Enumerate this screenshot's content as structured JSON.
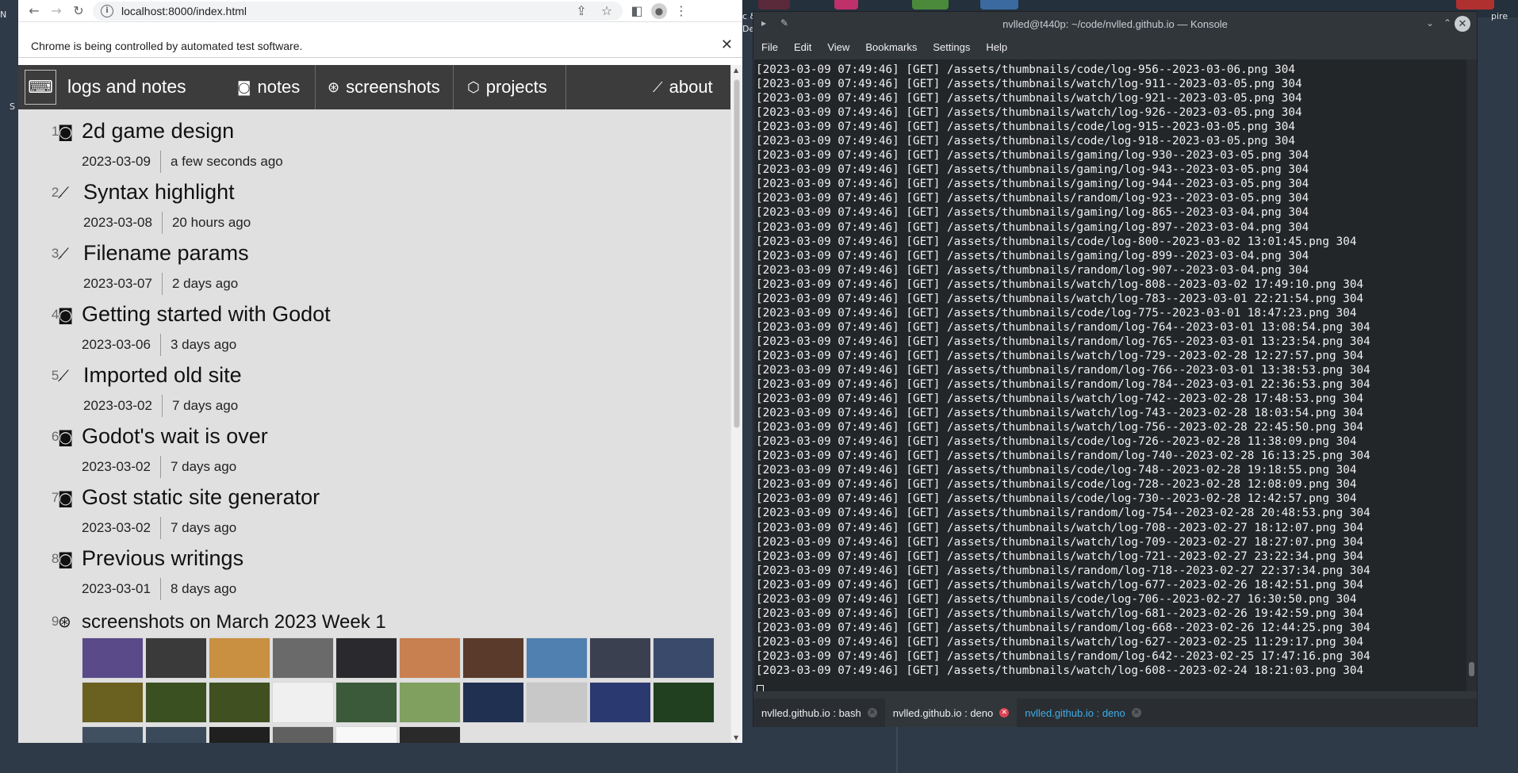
{
  "desktop": {
    "label_left": "N",
    "label_left2": "S",
    "label_right_a": "c &",
    "label_right_b": "De",
    "label_right_c": "pire"
  },
  "browser": {
    "url": "localhost:8000/index.html",
    "infobar_text": "Chrome is being controlled by automated test software.",
    "close_glyph": "✕",
    "icons": {
      "back": "←",
      "forward": "→",
      "reload": "↻",
      "site_info": "i",
      "share": "⇪",
      "star": "☆",
      "sidebar": "◧",
      "profile": "●",
      "menu": "⋮"
    }
  },
  "site": {
    "logo_icon": "⌨",
    "brand": "logs and notes",
    "nav": [
      {
        "icon": "◙",
        "label": "notes"
      },
      {
        "icon": "⊛",
        "label": "screenshots"
      },
      {
        "icon": "⬡",
        "label": "projects"
      },
      {
        "icon": "⟋",
        "label": "about"
      }
    ],
    "posts": [
      {
        "num": "1.",
        "icon": "◙",
        "title": "2d game design",
        "date": "2023-03-09",
        "ago": "a few seconds ago"
      },
      {
        "num": "2.",
        "icon": "⟋",
        "title": "Syntax highlight",
        "date": "2023-03-08",
        "ago": "20 hours ago"
      },
      {
        "num": "3.",
        "icon": "⟋",
        "title": "Filename params",
        "date": "2023-03-07",
        "ago": "2 days ago"
      },
      {
        "num": "4.",
        "icon": "◙",
        "title": "Getting started with Godot",
        "date": "2023-03-06",
        "ago": "3 days ago"
      },
      {
        "num": "5.",
        "icon": "⟋",
        "title": "Imported old site",
        "date": "2023-03-02",
        "ago": "7 days ago"
      },
      {
        "num": "6.",
        "icon": "◙",
        "title": "Godot's wait is over",
        "date": "2023-03-02",
        "ago": "7 days ago"
      },
      {
        "num": "7.",
        "icon": "◙",
        "title": "Gost static site generator",
        "date": "2023-03-02",
        "ago": "7 days ago"
      },
      {
        "num": "8.",
        "icon": "◙",
        "title": "Previous writings",
        "date": "2023-03-01",
        "ago": "8 days ago"
      },
      {
        "num": "9.",
        "icon": "⊛",
        "title": "screenshots on March 2023 Week 1",
        "date": "",
        "ago": ""
      }
    ],
    "thumb_colors": [
      "#5a4a8a",
      "#3a3a3a",
      "#c89040",
      "#6a6a6a",
      "#2a2a2e",
      "#c88050",
      "#5a3a2a",
      "#5080b0",
      "#3a4050",
      "#3a4a6a",
      "#6a6020",
      "#3a5020",
      "#405020",
      "#f0f0f0",
      "#3a5a3a",
      "#80a060",
      "#203050",
      "#c8c8c8",
      "#2a3a70",
      "#204020",
      "#405060",
      "#3a4a5a",
      "#202020",
      "#606060",
      "#f8f8f8",
      "#2a2a2a"
    ]
  },
  "konsole": {
    "title": "nvlled@t440p: ~/code/nvlled.github.io — Konsole",
    "menu": [
      "File",
      "Edit",
      "View",
      "Bookmarks",
      "Settings",
      "Help"
    ],
    "lines": [
      "[2023-03-09 07:49:46] [GET] /assets/thumbnails/code/log-956--2023-03-06.png 304",
      "[2023-03-09 07:49:46] [GET] /assets/thumbnails/watch/log-911--2023-03-05.png 304",
      "[2023-03-09 07:49:46] [GET] /assets/thumbnails/watch/log-921--2023-03-05.png 304",
      "[2023-03-09 07:49:46] [GET] /assets/thumbnails/watch/log-926--2023-03-05.png 304",
      "[2023-03-09 07:49:46] [GET] /assets/thumbnails/code/log-915--2023-03-05.png 304",
      "[2023-03-09 07:49:46] [GET] /assets/thumbnails/code/log-918--2023-03-05.png 304",
      "[2023-03-09 07:49:46] [GET] /assets/thumbnails/gaming/log-930--2023-03-05.png 304",
      "[2023-03-09 07:49:46] [GET] /assets/thumbnails/gaming/log-943--2023-03-05.png 304",
      "[2023-03-09 07:49:46] [GET] /assets/thumbnails/gaming/log-944--2023-03-05.png 304",
      "[2023-03-09 07:49:46] [GET] /assets/thumbnails/random/log-923--2023-03-05.png 304",
      "[2023-03-09 07:49:46] [GET] /assets/thumbnails/gaming/log-865--2023-03-04.png 304",
      "[2023-03-09 07:49:46] [GET] /assets/thumbnails/gaming/log-897--2023-03-04.png 304",
      "[2023-03-09 07:49:46] [GET] /assets/thumbnails/code/log-800--2023-03-02 13:01:45.png 304",
      "[2023-03-09 07:49:46] [GET] /assets/thumbnails/gaming/log-899--2023-03-04.png 304",
      "[2023-03-09 07:49:46] [GET] /assets/thumbnails/random/log-907--2023-03-04.png 304",
      "[2023-03-09 07:49:46] [GET] /assets/thumbnails/watch/log-808--2023-03-02 17:49:10.png 304",
      "[2023-03-09 07:49:46] [GET] /assets/thumbnails/watch/log-783--2023-03-01 22:21:54.png 304",
      "[2023-03-09 07:49:46] [GET] /assets/thumbnails/code/log-775--2023-03-01 18:47:23.png 304",
      "[2023-03-09 07:49:46] [GET] /assets/thumbnails/random/log-764--2023-03-01 13:08:54.png 304",
      "[2023-03-09 07:49:46] [GET] /assets/thumbnails/random/log-765--2023-03-01 13:23:54.png 304",
      "[2023-03-09 07:49:46] [GET] /assets/thumbnails/watch/log-729--2023-02-28 12:27:57.png 304",
      "[2023-03-09 07:49:46] [GET] /assets/thumbnails/random/log-766--2023-03-01 13:38:53.png 304",
      "[2023-03-09 07:49:46] [GET] /assets/thumbnails/random/log-784--2023-03-01 22:36:53.png 304",
      "[2023-03-09 07:49:46] [GET] /assets/thumbnails/watch/log-742--2023-02-28 17:48:53.png 304",
      "[2023-03-09 07:49:46] [GET] /assets/thumbnails/watch/log-743--2023-02-28 18:03:54.png 304",
      "[2023-03-09 07:49:46] [GET] /assets/thumbnails/watch/log-756--2023-02-28 22:45:50.png 304",
      "[2023-03-09 07:49:46] [GET] /assets/thumbnails/code/log-726--2023-02-28 11:38:09.png 304",
      "[2023-03-09 07:49:46] [GET] /assets/thumbnails/random/log-740--2023-02-28 16:13:25.png 304",
      "[2023-03-09 07:49:46] [GET] /assets/thumbnails/code/log-748--2023-02-28 19:18:55.png 304",
      "[2023-03-09 07:49:46] [GET] /assets/thumbnails/code/log-728--2023-02-28 12:08:09.png 304",
      "[2023-03-09 07:49:46] [GET] /assets/thumbnails/code/log-730--2023-02-28 12:42:57.png 304",
      "[2023-03-09 07:49:46] [GET] /assets/thumbnails/random/log-754--2023-02-28 20:48:53.png 304",
      "[2023-03-09 07:49:46] [GET] /assets/thumbnails/watch/log-708--2023-02-27 18:12:07.png 304",
      "[2023-03-09 07:49:46] [GET] /assets/thumbnails/watch/log-709--2023-02-27 18:27:07.png 304",
      "[2023-03-09 07:49:46] [GET] /assets/thumbnails/watch/log-721--2023-02-27 23:22:34.png 304",
      "[2023-03-09 07:49:46] [GET] /assets/thumbnails/random/log-718--2023-02-27 22:37:34.png 304",
      "[2023-03-09 07:49:46] [GET] /assets/thumbnails/watch/log-677--2023-02-26 18:42:51.png 304",
      "[2023-03-09 07:49:46] [GET] /assets/thumbnails/code/log-706--2023-02-27 16:30:50.png 304",
      "[2023-03-09 07:49:46] [GET] /assets/thumbnails/watch/log-681--2023-02-26 19:42:59.png 304",
      "[2023-03-09 07:49:46] [GET] /assets/thumbnails/random/log-668--2023-02-26 12:44:25.png 304",
      "[2023-03-09 07:49:46] [GET] /assets/thumbnails/watch/log-627--2023-02-25 11:29:17.png 304",
      "[2023-03-09 07:49:46] [GET] /assets/thumbnails/random/log-642--2023-02-25 17:47:16.png 304",
      "[2023-03-09 07:49:46] [GET] /assets/thumbnails/watch/log-608--2023-02-24 18:21:03.png 304"
    ],
    "tabs": [
      {
        "label": "nvlled.github.io : bash",
        "state": "normal"
      },
      {
        "label": "nvlled.github.io : deno",
        "state": "active"
      },
      {
        "label": "nvlled.github.io : deno",
        "state": "link"
      }
    ]
  }
}
